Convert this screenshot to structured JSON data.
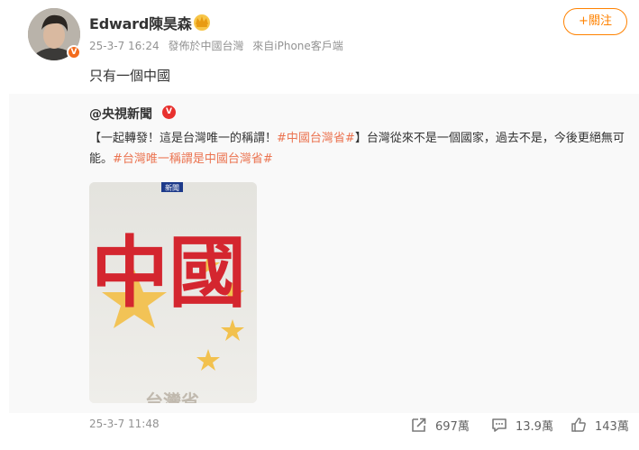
{
  "post": {
    "username": "Edward陳昊森",
    "meta_time": "25-3-7 16:24",
    "meta_location": "發佈於中國台灣",
    "meta_source": "來自iPhone客戶端",
    "follow_label": "+關注",
    "text": "只有一個中國"
  },
  "repost": {
    "author": "@央視新聞",
    "text_part1": "【一起轉發！這是台灣唯一的稱謂！",
    "topic1": "#中國台灣省#",
    "text_part2": "】台灣從來不是一個國家，過去不是，今後更絕無可能。",
    "topic2": "#台灣唯一稱謂是中國台灣省#",
    "image": {
      "badge": "新聞",
      "big_text": "中國",
      "bottom_text": "台灣省"
    }
  },
  "footer": {
    "time": "25-3-7 11:48",
    "repost_count": "697萬",
    "comment_count": "13.9萬",
    "like_count": "143萬"
  },
  "icons": {
    "crown": "crown-icon",
    "verified": "verified-badge-icon",
    "repost": "share-icon",
    "comment": "comment-icon",
    "like": "thumbs-up-icon"
  },
  "colors": {
    "accent": "#ff8200",
    "topic": "#eb7350",
    "meta_gray": "#939393",
    "repost_bg": "#f9f9f9"
  }
}
